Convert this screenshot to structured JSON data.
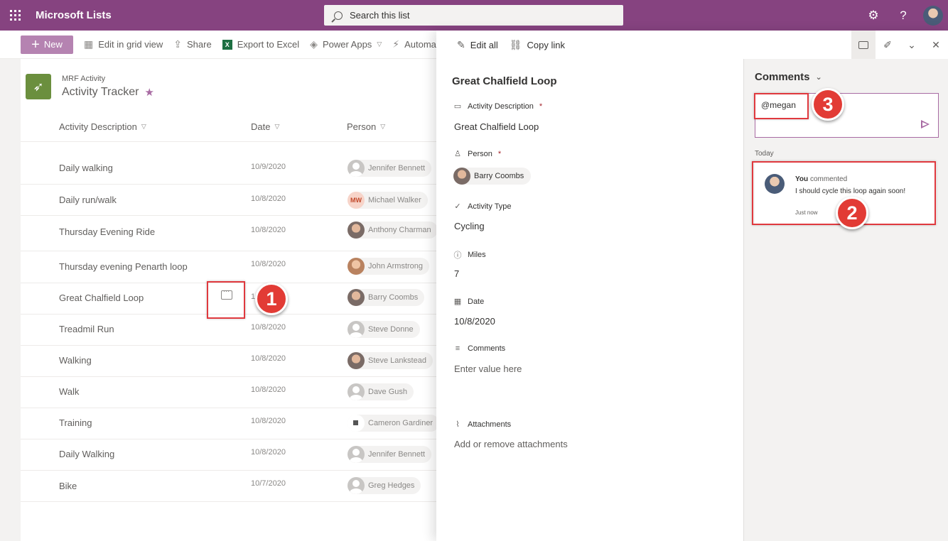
{
  "suite": {
    "app_name": "Microsoft Lists",
    "search_placeholder": "Search this list",
    "settings_icon": "gear-icon",
    "help_label": "?"
  },
  "commandbar": {
    "new_label": "New",
    "items": [
      "Edit in grid view",
      "Share",
      "Export to Excel",
      "Power Apps",
      "Automa"
    ]
  },
  "list": {
    "site": "MRF Activity",
    "title": "Activity Tracker",
    "columns": [
      "Activity Description",
      "Date",
      "Person"
    ],
    "rows": [
      {
        "desc": "Daily walking",
        "date": "10/9/2020",
        "person": "Jennifer Bennett"
      },
      {
        "desc": "Daily run/walk",
        "date": "10/8/2020",
        "person": "Michael Walker",
        "initials": "MW"
      },
      {
        "desc": "Thursday Evening Ride",
        "date": "10/8/2020",
        "person": "Anthony Charman"
      },
      {
        "desc": "Thursday evening Penarth loop",
        "date": "10/8/2020",
        "person": "John Armstrong"
      },
      {
        "desc": "Great Chalfield Loop",
        "date": "1",
        "person": "Barry Coombs"
      },
      {
        "desc": "Treadmil Run",
        "date": "10/8/2020",
        "person": "Steve Donne"
      },
      {
        "desc": "Walking",
        "date": "10/8/2020",
        "person": "Steve Lankstead"
      },
      {
        "desc": "Walk",
        "date": "10/8/2020",
        "person": "Dave Gush"
      },
      {
        "desc": "Training",
        "date": "10/8/2020",
        "person": "Cameron Gardiner"
      },
      {
        "desc": "Daily Walking",
        "date": "10/8/2020",
        "person": "Jennifer Bennett"
      },
      {
        "desc": "Bike",
        "date": "10/7/2020",
        "person": "Greg Hedges"
      }
    ]
  },
  "panel": {
    "edit_all": "Edit all",
    "copy_link": "Copy link",
    "title": "Great Chalfield Loop",
    "fields": {
      "activity_description": {
        "label": "Activity Description",
        "req": "*",
        "value": "Great Chalfield Loop"
      },
      "person": {
        "label": "Person",
        "req": "*",
        "value": "Barry Coombs"
      },
      "activity_type": {
        "label": "Activity Type",
        "value": "Cycling"
      },
      "miles": {
        "label": "Miles",
        "value": "7"
      },
      "date": {
        "label": "Date",
        "value": "10/8/2020"
      },
      "comments": {
        "label": "Comments",
        "value": "Enter value here"
      },
      "attachments": {
        "label": "Attachments",
        "value": "Add or remove attachments"
      }
    }
  },
  "comments_pane": {
    "title": "Comments",
    "input_value": "@megan",
    "group": "Today",
    "comment": {
      "author": "You",
      "action": "commented",
      "text": "I should cycle this loop again soon!",
      "time": "Just now"
    }
  },
  "annotations": [
    "1",
    "2",
    "3"
  ],
  "colors": {
    "suite": "#864380",
    "accent": "#a86ba3",
    "annotation": "#e23b35"
  }
}
